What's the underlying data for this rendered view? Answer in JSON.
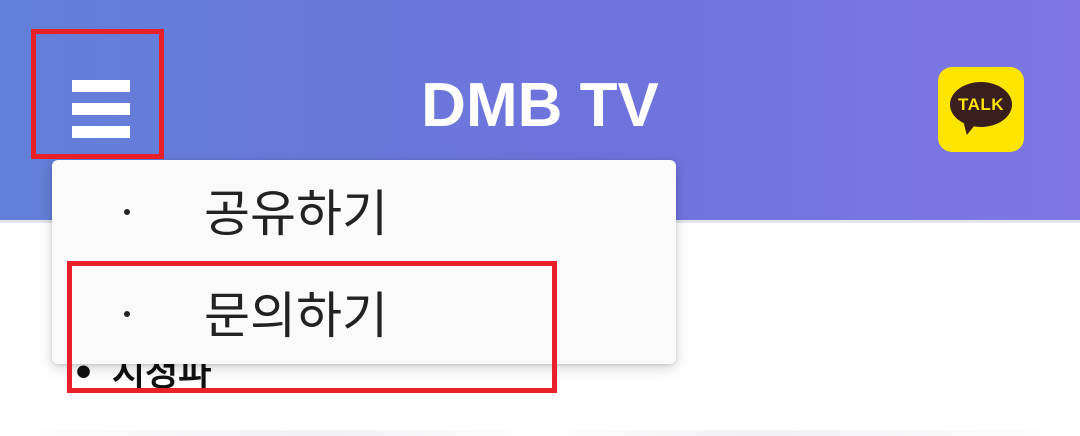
{
  "app_bar": {
    "title": "DMB TV",
    "menu_icon": "hamburger-menu-icon",
    "kakao_label": "TALK",
    "kakao_icon": "kakaotalk-icon",
    "gradient_start": "#6280d8",
    "gradient_end": "#7f76e3"
  },
  "background": {
    "heading_bullet": "•",
    "heading": "시청파"
  },
  "dropdown": {
    "items": [
      {
        "label": "공유하기"
      },
      {
        "label": "문의하기"
      }
    ]
  },
  "annotations": {
    "highlight_color": "#e8202a"
  }
}
